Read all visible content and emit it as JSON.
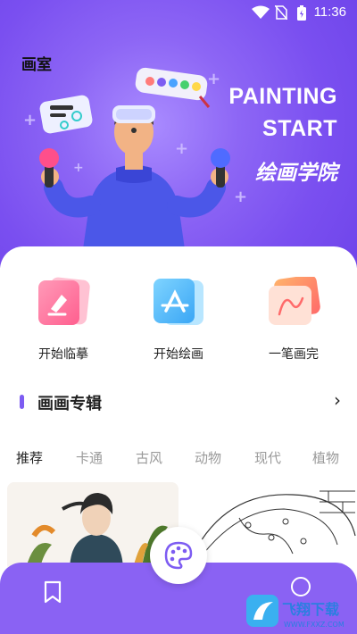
{
  "status": {
    "time": "11:36"
  },
  "hero": {
    "title": "画室",
    "english_line1": "PAINTING",
    "english_line2": "START",
    "chinese_title": "绘画学院"
  },
  "tools": [
    {
      "label": "开始临摹",
      "icon": "copy-draw-icon"
    },
    {
      "label": "开始绘画",
      "icon": "app-draw-icon"
    },
    {
      "label": "一笔画完",
      "icon": "one-stroke-icon"
    }
  ],
  "section": {
    "title": "画画专辑",
    "arrow": "›"
  },
  "tabs": [
    "推荐",
    "卡通",
    "古风",
    "动物",
    "现代",
    "植物"
  ],
  "active_tab": "推荐",
  "colors": {
    "accent": "#7d5cf2",
    "nav": "#8a62f3"
  },
  "watermark": {
    "text": "飞翔下载",
    "sub": "WWW.FXXZ.COM"
  }
}
